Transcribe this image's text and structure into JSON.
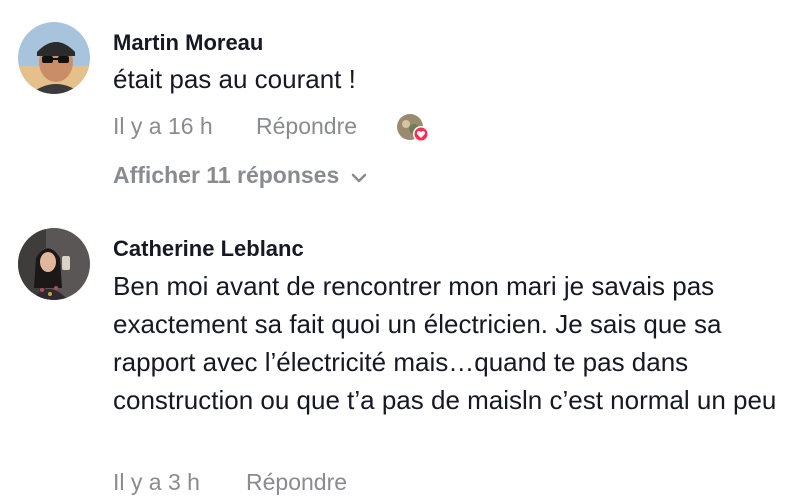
{
  "comments": [
    {
      "author": "Martin Moreau",
      "text": "était pas au courant !",
      "time": "Il y a 16 h",
      "reply_label": "Répondre",
      "view_replies_label": "Afficher 11 réponses",
      "liked_by_creator": true
    },
    {
      "author": "Catherine Leblanc",
      "text": "Ben moi avant de rencontrer mon mari je savais pas exactement sa fait quoi un électricien. Je sais que sa rapport avec l’électricité mais…quand te pas dans construction ou que t’a pas de maisln c’est normal un peu",
      "time": "Il y a 3 h",
      "reply_label": "Répondre"
    }
  ],
  "icons": {
    "chevron": "chevron-down-icon",
    "heart": "heart-icon"
  },
  "colors": {
    "text": "#161823",
    "muted": "#8a8b91",
    "heart": "#fe2c55"
  }
}
